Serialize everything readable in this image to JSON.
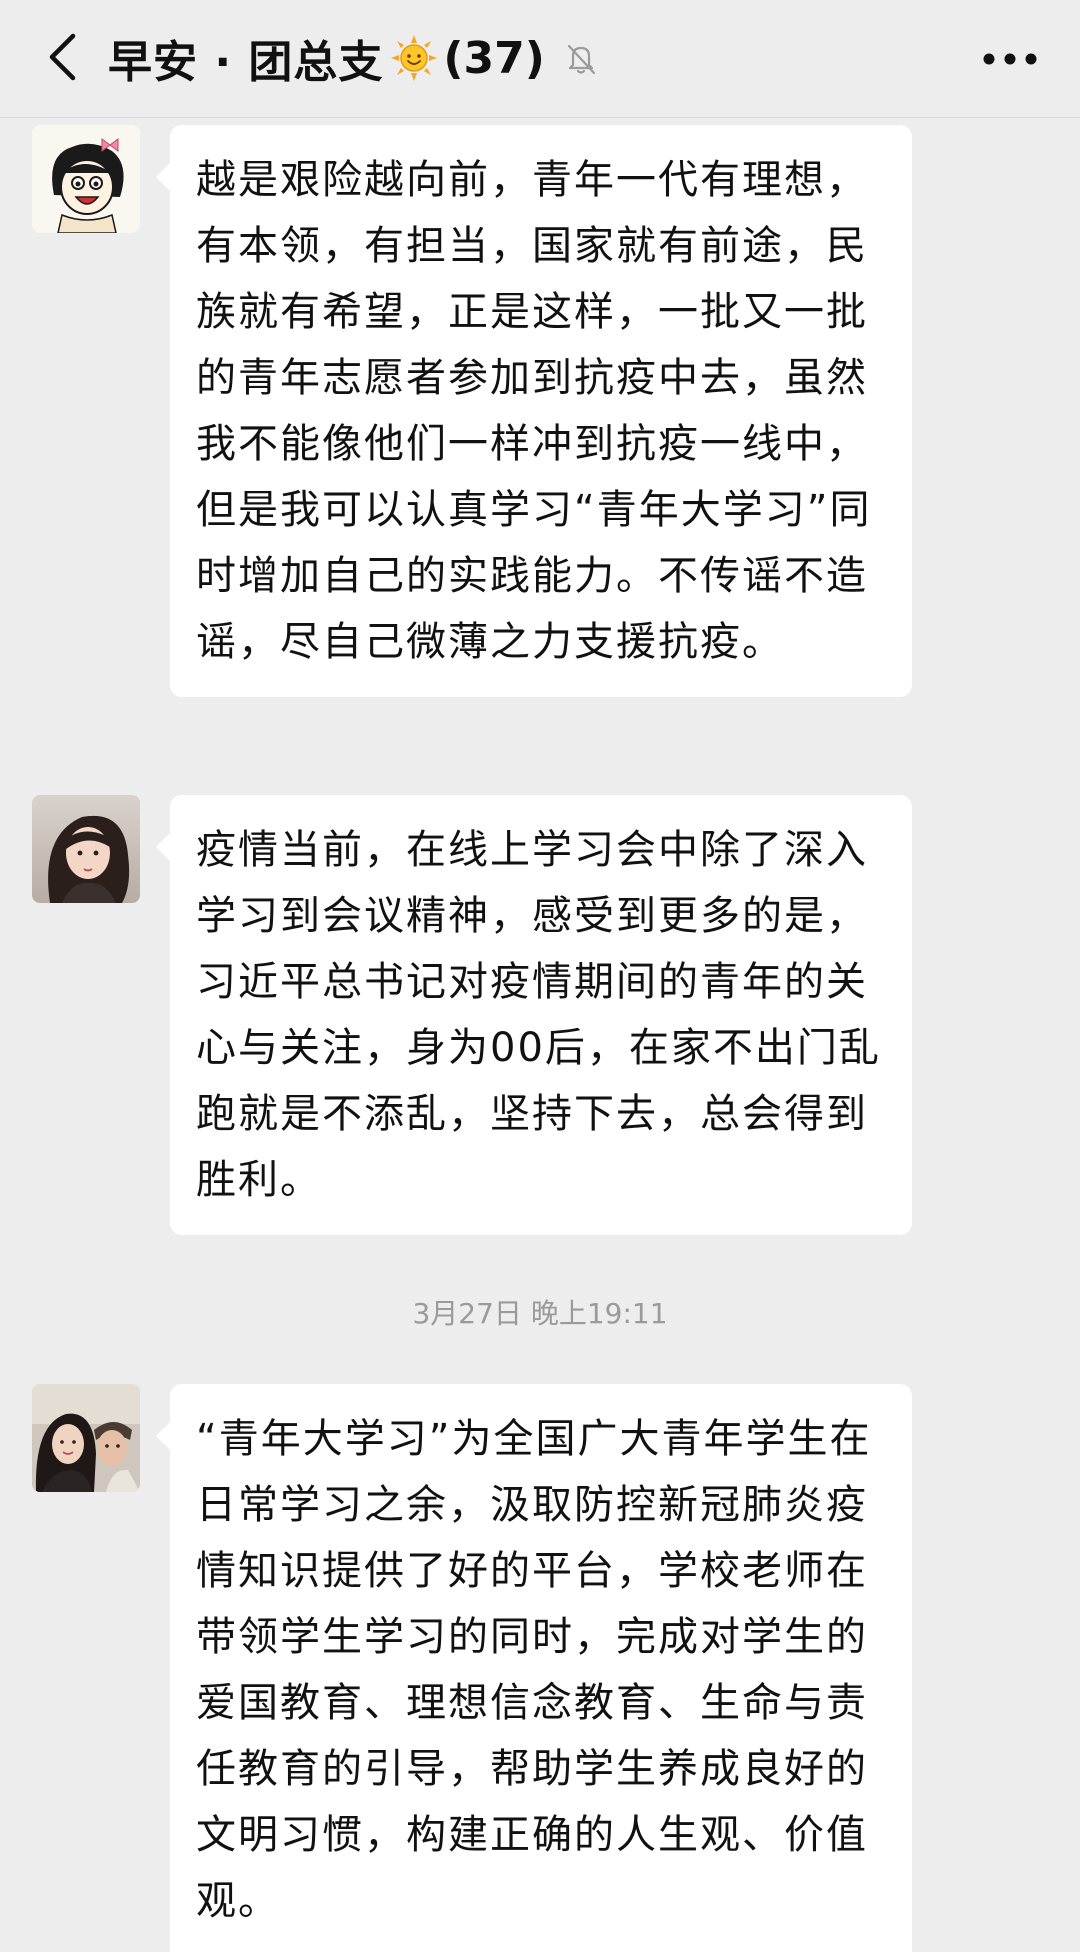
{
  "header": {
    "title": "早安 · 团总支",
    "member_count": "(37)",
    "icons": {
      "back": "chevron-left-icon",
      "sun": "sun-emoji-icon",
      "mute": "bell-muted-icon",
      "more": "more-icon"
    }
  },
  "messages": [
    {
      "avatar": "cartoon-girl-avatar",
      "text": "越是艰险越向前，青年一代有理想，有本领，有担当，国家就有前途，民族就有希望，正是这样，一批又一批的青年志愿者参加到抗疫中去，虽然我不能像他们一样冲到抗疫一线中，但是我可以认真学习“青年大学习”同时增加自己的实践能力。不传谣不造谣，尽自己微薄之力支援抗疫。"
    },
    {
      "avatar": "girl-photo-avatar",
      "text": "疫情当前，在线上学习会中除了深入学习到会议精神，感受到更多的是，习近平总书记对疫情期间的青年的关心与关注，身为00后，在家不出门乱跑就是不添乱，坚持下去，总会得到胜利。"
    },
    {
      "avatar": "two-people-photo-avatar",
      "text": "“青年大学习”为全国广大青年学生在日常学习之余，汲取防控新冠肺炎疫情知识提供了好的平台，学校老师在带领学生学习的同时，完成对学生的爱国教育、理想信念教育、生命与责任教育的引导，帮助学生养成良好的文明习惯，构建正确的人生观、价值观。"
    }
  ],
  "timestamp": "3月27日 晚上19:11",
  "colors": {
    "background": "#ededed",
    "bubble": "#ffffff",
    "timestamp": "#9a9a9a"
  }
}
